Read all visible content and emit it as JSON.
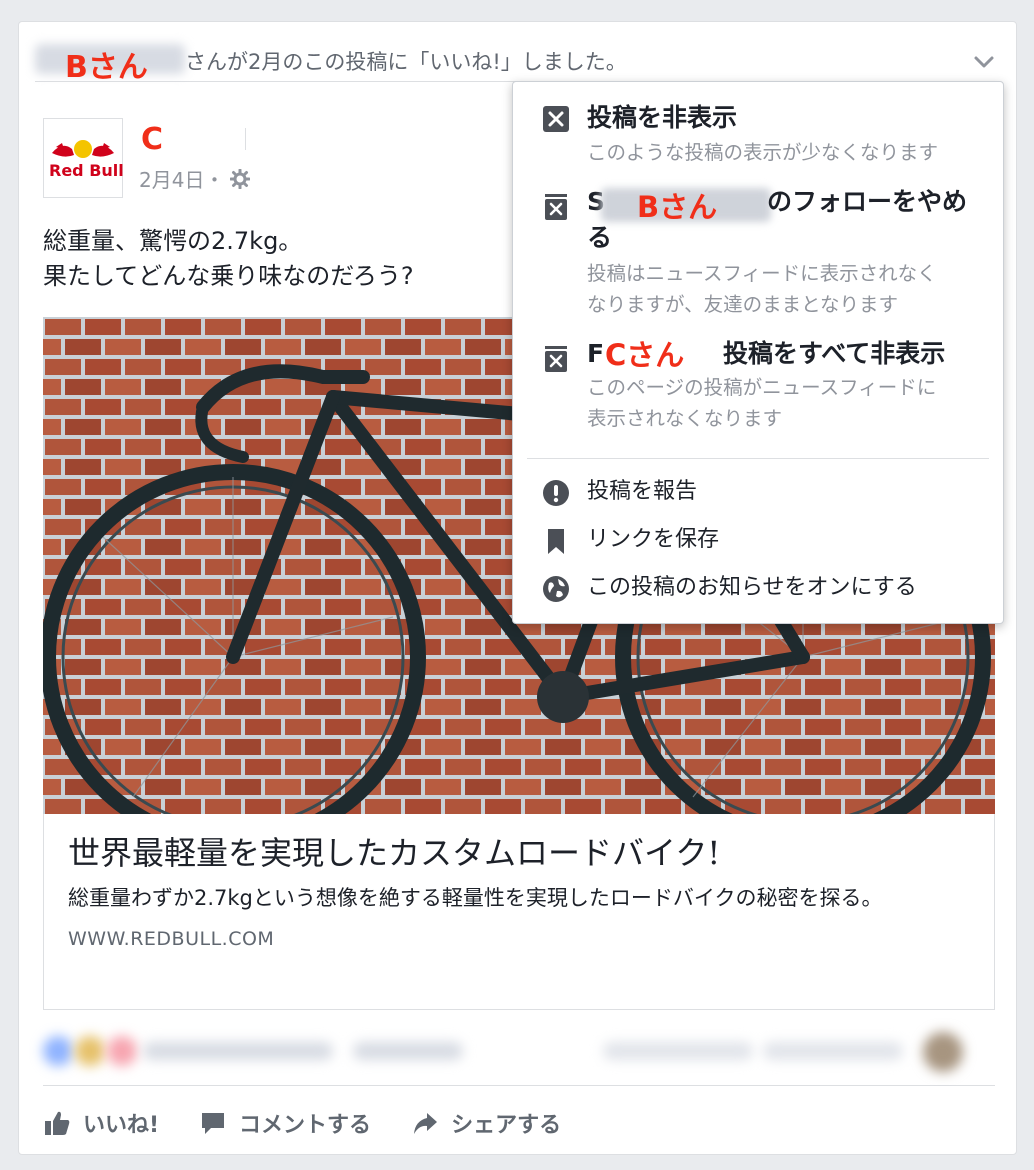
{
  "story": {
    "actor_tag": "Bさん",
    "text": "さんが2月のこの投稿に「いいね!」しました。"
  },
  "page": {
    "name": "C",
    "logo_text": "Red Bull",
    "date": "2月4日・"
  },
  "post": {
    "line1": "総重量、驚愕の2.7kg。",
    "line2": "果たしてどんな乗り味なのだろう?"
  },
  "link_preview": {
    "title": "世界最軽量を実現したカスタムロードバイク!",
    "description": "総重量わずか2.7kgという想像を絶する軽量性を実現したロードバイクの秘密を探る。",
    "domain": "WWW.REDBULL.COM"
  },
  "actions": {
    "like": "いいね!",
    "comment": "コメントする",
    "share": "シェアする"
  },
  "menu": {
    "hide_post": {
      "title": "投稿を非表示",
      "sub": "このような投稿の表示が少なくなります"
    },
    "unfollow": {
      "prefix": "S",
      "name_tag": "Bさん",
      "title_suffix": "のフォローをやめ",
      "title_line2": "る",
      "sub1": "投稿はニュースフィードに表示されなく",
      "sub2": "なりますが、友達のままとなります"
    },
    "hide_all": {
      "prefix": "F",
      "name_tag": "Cさん",
      "title_suffix": "投稿をすべて非表示",
      "sub1": "このページの投稿がニュースフィードに",
      "sub2": "表示されなくなります"
    },
    "report": "投稿を報告",
    "save": "リンクを保存",
    "notify": "この投稿のお知らせをオンにする"
  },
  "colors": {
    "accent_red": "#f02e19",
    "fb_grey": "#606770",
    "bg": "#e9ebee"
  }
}
